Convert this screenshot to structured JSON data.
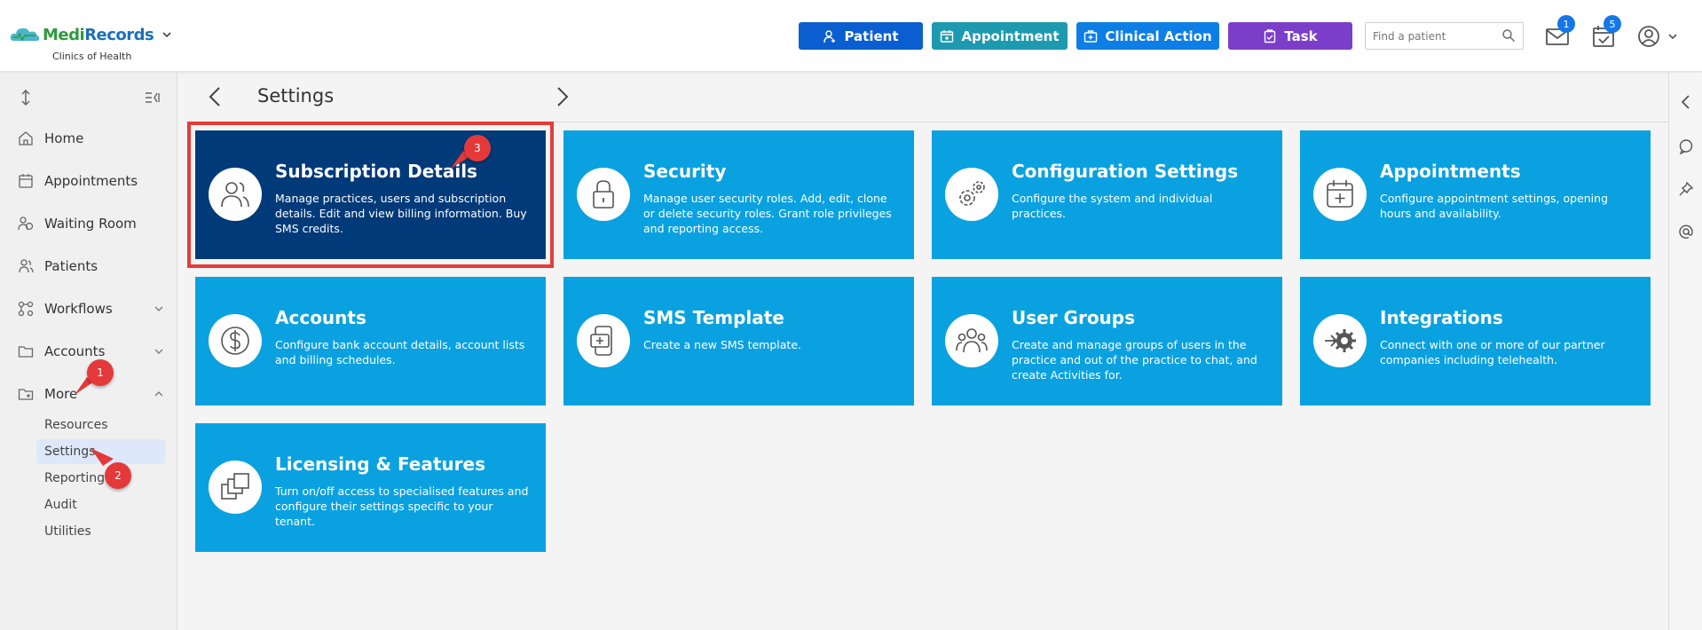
{
  "app": {
    "brand_part1": "Medi",
    "brand_part2": "Records",
    "practice_name": "Clinics of Health"
  },
  "toolbar": {
    "patient_label": "Patient",
    "appointment_label": "Appointment",
    "clinical_action_label": "Clinical Action",
    "task_label": "Task",
    "search_placeholder": "Find a patient",
    "messages_badge": "1",
    "tasks_badge": "5"
  },
  "sidebar": {
    "items": [
      {
        "label": "Home"
      },
      {
        "label": "Appointments"
      },
      {
        "label": "Waiting Room"
      },
      {
        "label": "Patients"
      },
      {
        "label": "Workflows"
      },
      {
        "label": "Accounts"
      },
      {
        "label": "More"
      }
    ],
    "subitems": [
      {
        "label": "Resources"
      },
      {
        "label": "Settings"
      },
      {
        "label": "Reporting"
      },
      {
        "label": "Audit"
      },
      {
        "label": "Utilities"
      }
    ]
  },
  "page": {
    "title": "Settings"
  },
  "tiles": [
    {
      "title": "Subscription Details",
      "description": "Manage practices, users and subscription details. Edit and view billing information. Buy SMS credits.",
      "icon": "users-icon"
    },
    {
      "title": "Security",
      "description": "Manage user security roles. Add, edit, clone or delete security roles. Grant role privileges and reporting access.",
      "icon": "lock-icon"
    },
    {
      "title": "Configuration Settings",
      "description": "Configure the system and individual practices.",
      "icon": "gears-icon"
    },
    {
      "title": "Appointments",
      "description": "Configure appointment settings, opening hours and availability.",
      "icon": "calendar-plus-icon"
    },
    {
      "title": "Accounts",
      "description": "Configure bank account details, account lists and billing schedules.",
      "icon": "dollar-icon"
    },
    {
      "title": "SMS Template",
      "description": "Create a new SMS template.",
      "icon": "phone-message-icon"
    },
    {
      "title": "User Groups",
      "description": "Create and manage groups of users in the practice and out of the practice to chat, and create Activities for.",
      "icon": "user-group-icon"
    },
    {
      "title": "Integrations",
      "description": "Connect with one or more of our partner companies including telehealth.",
      "icon": "integration-gear-icon"
    },
    {
      "title": "Licensing & Features",
      "description": "Turn on/off access to specialised features and configure their settings specific to your tenant.",
      "icon": "stacked-squares-icon"
    }
  ],
  "markers": [
    "1",
    "2",
    "3"
  ],
  "colors": {
    "tile": "#0aa1e0",
    "tile_active": "#003a78",
    "highlight": "#e63b3b",
    "patient_btn": "#0a5ed0",
    "appointment_btn": "#1e9ab0",
    "clinical_btn": "#0d7ee6",
    "task_btn": "#7b3ec9"
  }
}
